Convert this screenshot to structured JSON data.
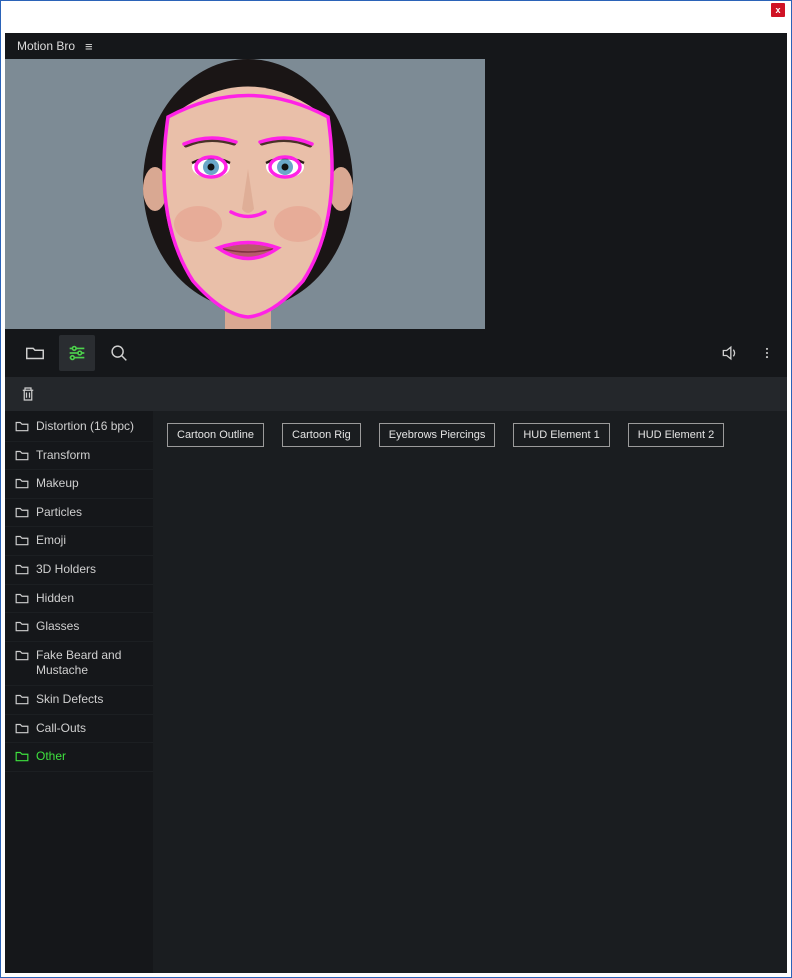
{
  "window": {
    "close_label": "x"
  },
  "header": {
    "title": "Motion Bro"
  },
  "sidebar": {
    "items": [
      {
        "label": "Distortion (16 bpc)",
        "active": false
      },
      {
        "label": "Transform",
        "active": false
      },
      {
        "label": "Makeup",
        "active": false
      },
      {
        "label": "Particles",
        "active": false
      },
      {
        "label": "Emoji",
        "active": false
      },
      {
        "label": "3D Holders",
        "active": false
      },
      {
        "label": "Hidden",
        "active": false
      },
      {
        "label": "Glasses",
        "active": false
      },
      {
        "label": "Fake Beard and Mustache",
        "active": false
      },
      {
        "label": "Skin Defects",
        "active": false
      },
      {
        "label": "Call-Outs",
        "active": false
      },
      {
        "label": "Other",
        "active": true
      }
    ]
  },
  "presets": [
    {
      "label": "Cartoon Outline"
    },
    {
      "label": "Cartoon Rig"
    },
    {
      "label": "Eyebrows Piercings"
    },
    {
      "label": "HUD Element 1"
    },
    {
      "label": "HUD Element 2"
    }
  ],
  "icons": {
    "folder": "folder-icon",
    "sliders": "sliders-icon",
    "search": "search-icon",
    "sound": "sound-icon",
    "more": "more-icon",
    "trash": "trash-icon",
    "hamburger": "hamburger-icon"
  },
  "colors": {
    "accent_green": "#3ee23e",
    "tracker_magenta": "#ff22e6"
  }
}
